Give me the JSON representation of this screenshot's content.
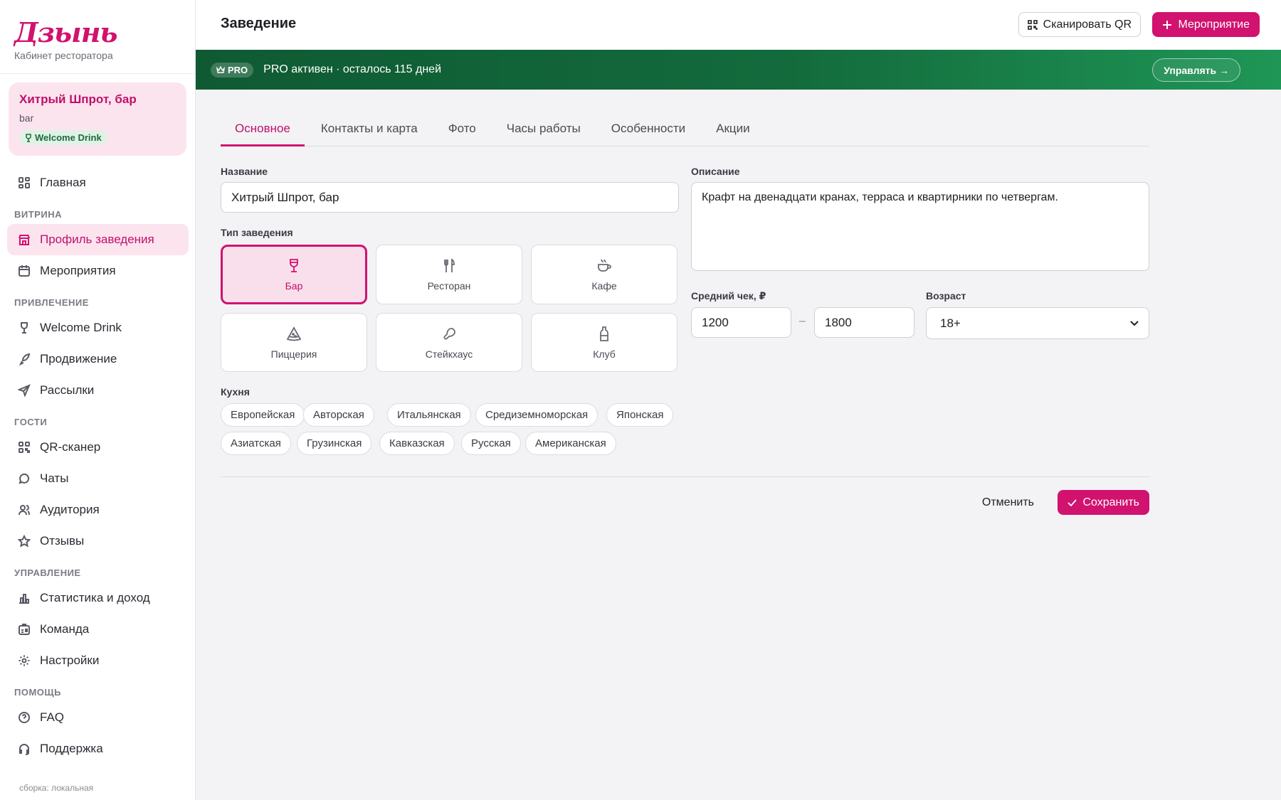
{
  "brand": {
    "logo": "Дзынь",
    "subtitle": "Кабинет ресторатора"
  },
  "venue": {
    "name": "Хитрый Шпрот, бар",
    "type": "bar",
    "badge": "Welcome Drink"
  },
  "nav": {
    "home": "Главная",
    "sections": {
      "showcase": "ВИТРИНА",
      "attraction": "ПРИВЛЕЧЕНИЕ",
      "guests": "ГОСТИ",
      "management": "УПРАВЛЕНИЕ",
      "help": "ПОМОЩЬ"
    },
    "items": {
      "profile": "Профиль заведения",
      "events": "Мероприятия",
      "welcome": "Welcome Drink",
      "promo": "Продвижение",
      "mailing": "Рассылки",
      "qr": "QR-сканер",
      "chats": "Чаты",
      "audience": "Аудитория",
      "reviews": "Отзывы",
      "stats": "Статистика и доход",
      "team": "Команда",
      "settings": "Настройки",
      "faq": "FAQ",
      "support": "Поддержка"
    },
    "build": "сборка: локальная"
  },
  "header": {
    "title": "Заведение",
    "scan": "Сканировать QR",
    "event": "Мероприятие"
  },
  "pro": {
    "badge": "PRO",
    "text": "PRO активен · осталось 115 дней",
    "manage": "Управлять →"
  },
  "tabs": [
    "Основное",
    "Контакты и карта",
    "Фото",
    "Часы работы",
    "Особенности",
    "Акции"
  ],
  "form": {
    "name_label": "Название",
    "name_value": "Хитрый Шпрот, бар",
    "type_label": "Тип заведения",
    "types": [
      "Бар",
      "Ресторан",
      "Кафе",
      "Пиццерия",
      "Стейкхаус",
      "Клуб"
    ],
    "selected_type": "Бар",
    "cuisine_label": "Кухня",
    "cuisines": [
      "Европейская",
      "Авторская",
      "Итальянская",
      "Средиземноморская",
      "Японская",
      "Азиатская",
      "Грузинская",
      "Кавказская",
      "Русская",
      "Американская"
    ],
    "desc_label": "Описание",
    "desc_value": "Крафт на двенадцати кранах, терраса и квартирники по четвергам.",
    "check_label": "Средний чек, ₽",
    "check_from": "1200",
    "check_to": "1800",
    "check_sep": "–",
    "age_label": "Возраст",
    "age_value": "18+"
  },
  "actions": {
    "cancel": "Отменить",
    "save": "Сохранить"
  },
  "colors": {
    "accent": "#d1126f",
    "accent_soft": "#fce4ef",
    "pro_green": "#136b3c"
  }
}
